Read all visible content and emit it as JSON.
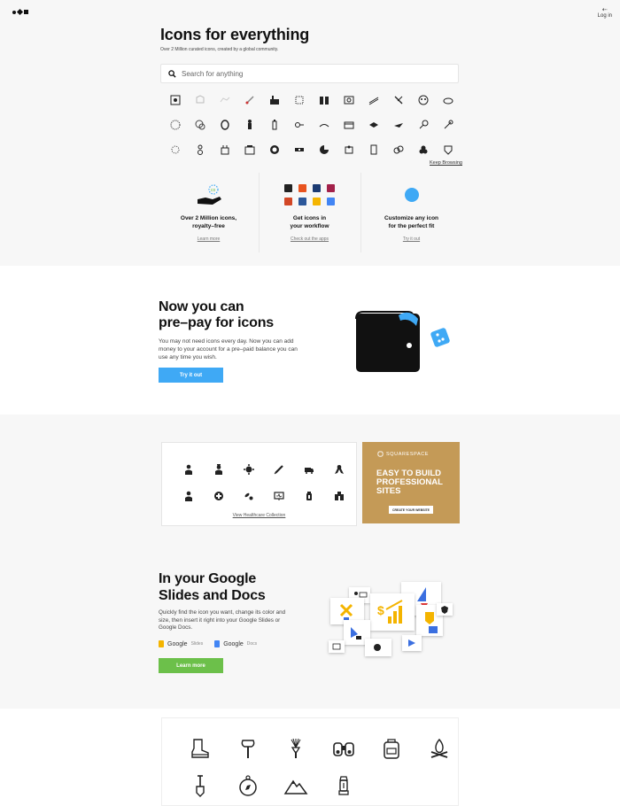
{
  "header": {
    "login_label": "Log in",
    "login_icon": "arrow-left-icon"
  },
  "hero": {
    "title": "Icons for everything",
    "subtitle": "Over 2 Million curated icons, created by a global community.",
    "search_placeholder": "Search for anything",
    "keep_browsing": "Keep Browsing"
  },
  "features": [
    {
      "title_line1": "Over 2 Million icons,",
      "title_line2": "royalty–free",
      "link": "Learn more"
    },
    {
      "title_line1": "Get icons in",
      "title_line2": "your workflow",
      "link": "Check out the apps"
    },
    {
      "title_line1": "Customize any icon",
      "title_line2": "for the perfect fit",
      "link": "Try it out"
    }
  ],
  "prepay": {
    "title_line1": "Now you can",
    "title_line2": "pre–pay for icons",
    "description": "You may not need icons every day. Now you can add money to your account for a pre–paid balance you can use any time you wish.",
    "button": "Try it out"
  },
  "healthcare": {
    "link": "View Healthcare Collection"
  },
  "ad": {
    "brand": "SQUARESPACE",
    "headline_line1": "EASY TO BUILD",
    "headline_line2": "PROFESSIONAL",
    "headline_line3": "SITES",
    "cta": "CREATE YOUR WEBSITE"
  },
  "google": {
    "title_line1": "In your Google",
    "title_line2": "Slides and Docs",
    "description": "Quickly find the icon you want, change its color and size, then insert it right into your Google Slides or Google Docs.",
    "slides_label": "Google",
    "slides_sub": "Slides",
    "docs_label": "Google",
    "docs_sub": "Docs",
    "button": "Learn more"
  },
  "colors": {
    "accent_blue": "#3fa9f5",
    "accent_green": "#6cc04a",
    "ad_gold": "#c49a57",
    "slides_yellow": "#f4b400",
    "docs_blue": "#4285f4"
  }
}
